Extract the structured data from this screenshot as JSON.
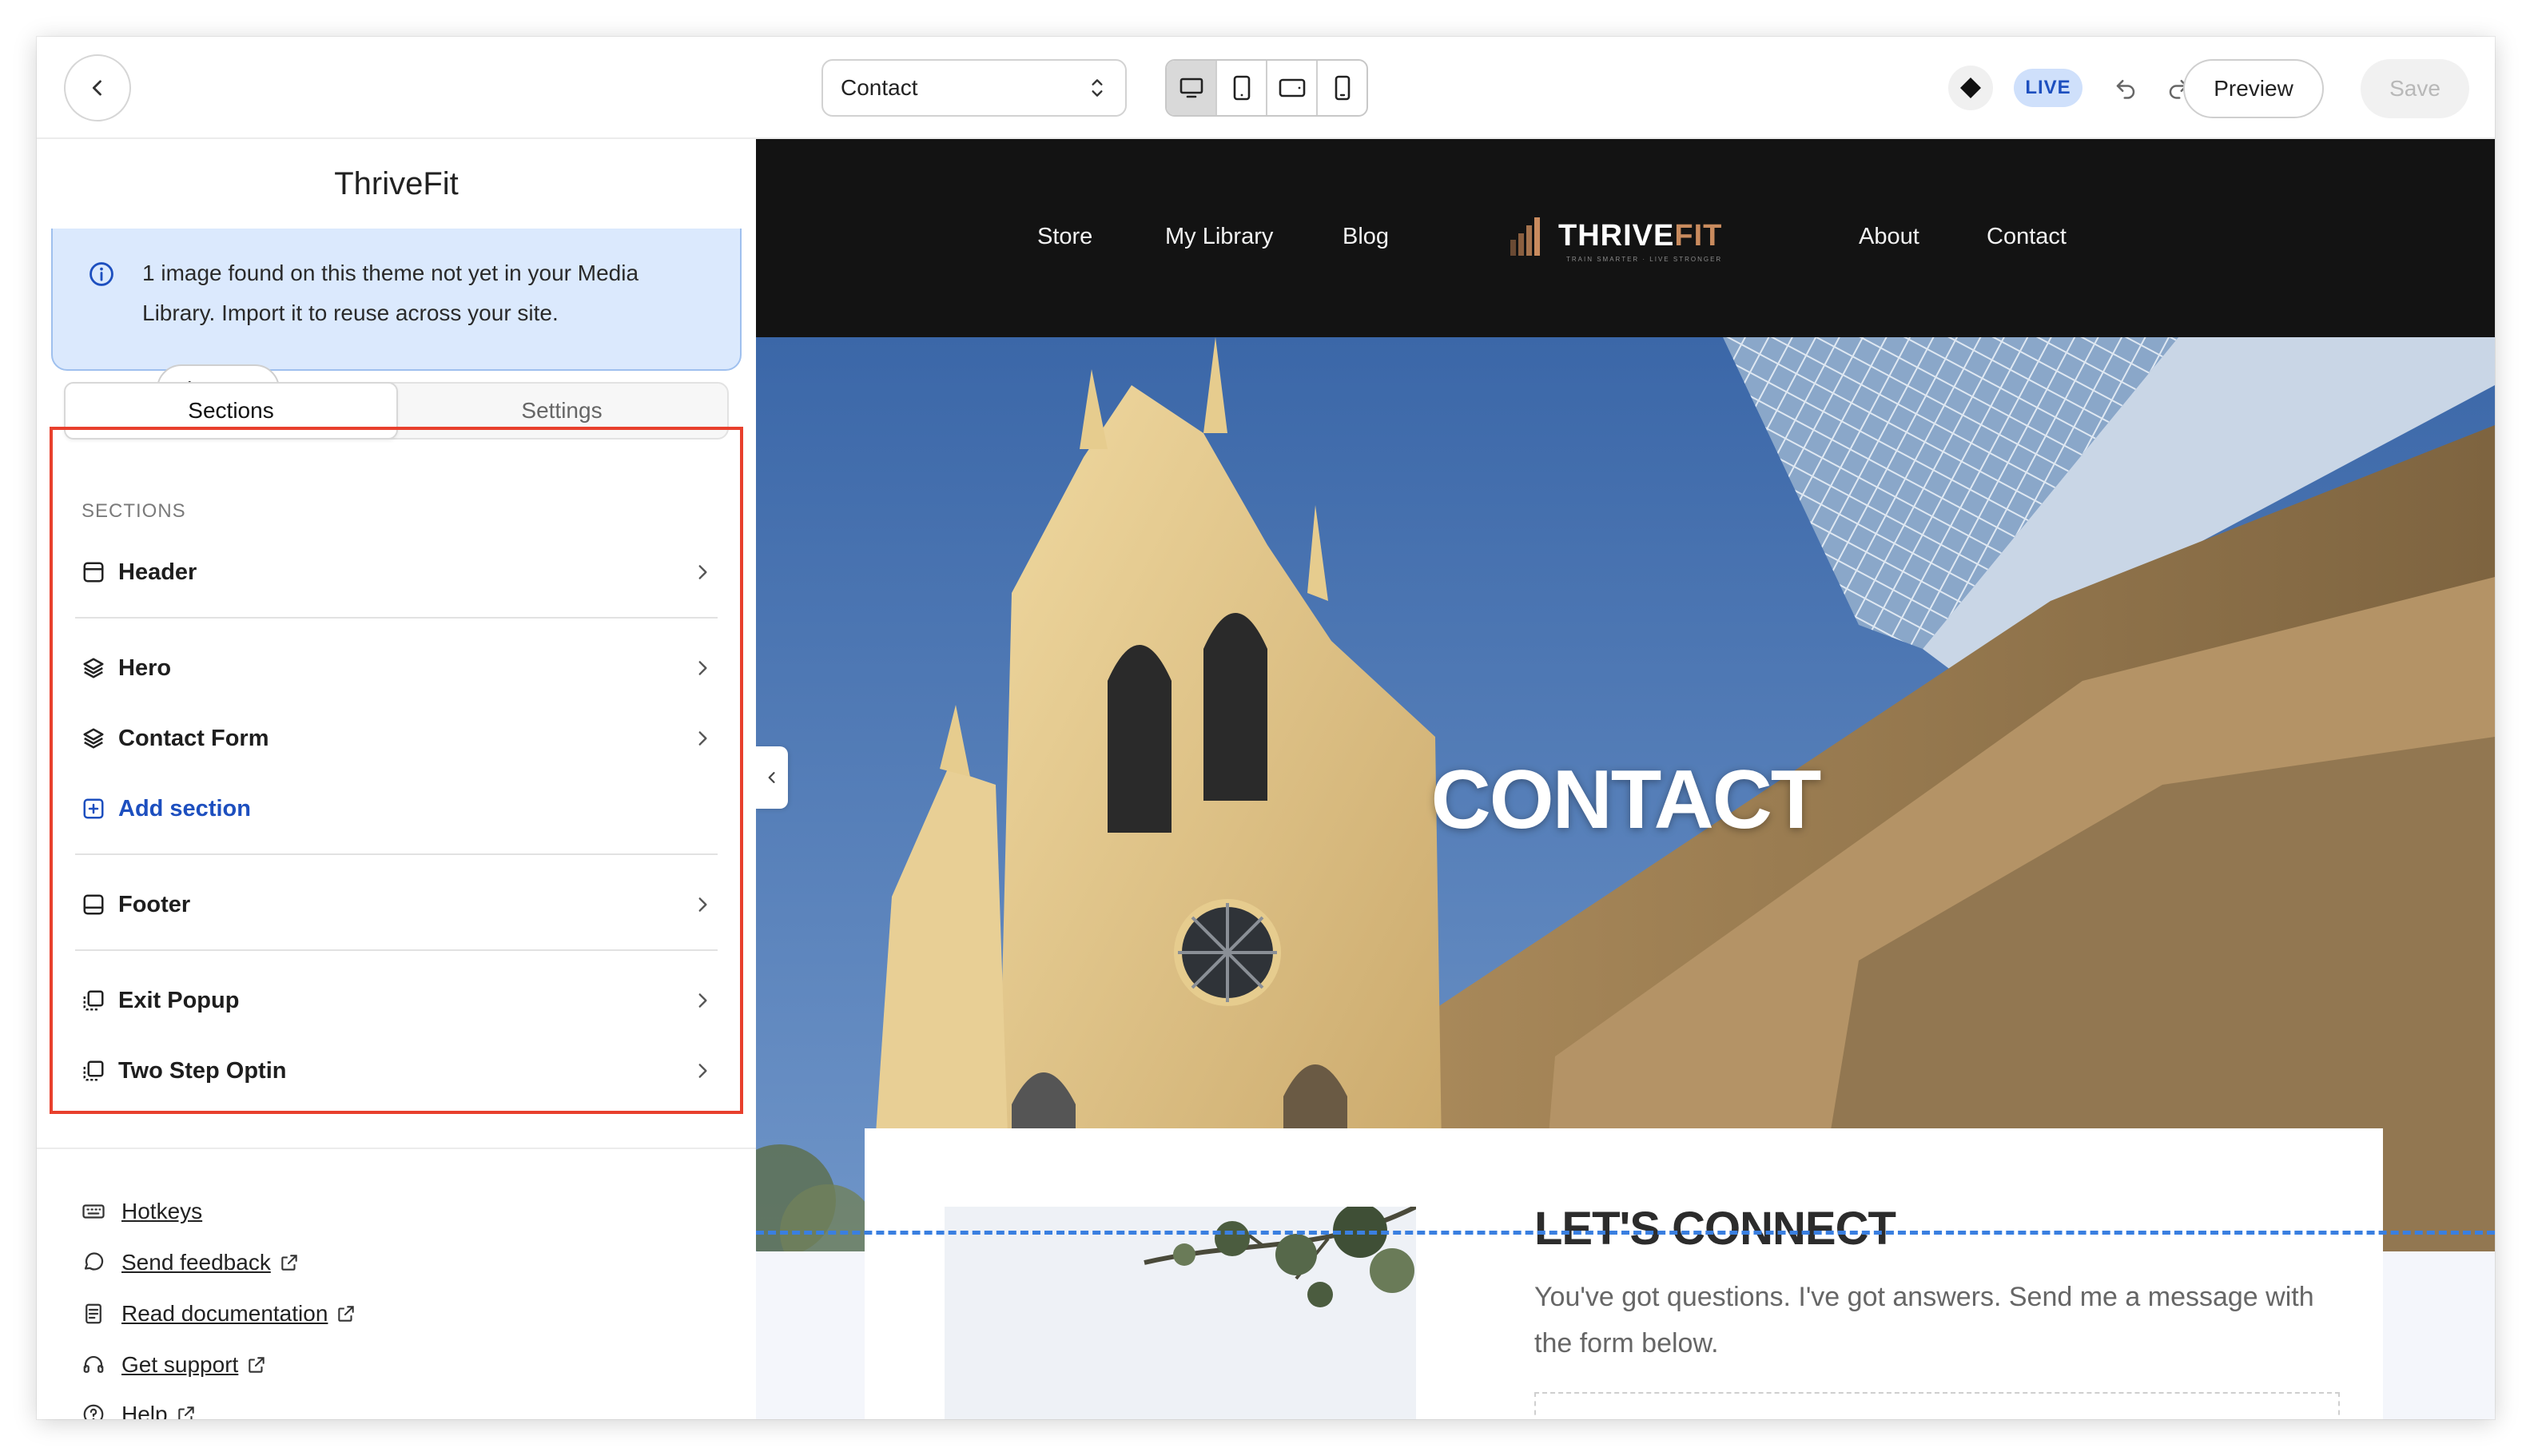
{
  "toolbar": {
    "page_select": {
      "value": "Contact"
    },
    "devices": [
      "desktop-icon",
      "tablet-portrait-icon",
      "tablet-landscape-icon",
      "mobile-icon"
    ],
    "live_label": "LIVE",
    "preview_label": "Preview",
    "save_label": "Save"
  },
  "sidebar": {
    "site_name": "ThriveFit",
    "notice": {
      "line1": "1 image found on this theme not yet in your Media",
      "line2": "Library. Import it to reuse across your site.",
      "import_label": "Import"
    },
    "tabs": [
      {
        "label": "Sections",
        "active": true
      },
      {
        "label": "Settings",
        "active": false
      }
    ],
    "sections_caption": "SECTIONS",
    "sections": [
      {
        "label": "Header",
        "icon": "layout-header-icon"
      },
      {
        "label": "Hero",
        "icon": "layers-icon"
      },
      {
        "label": "Contact Form",
        "icon": "layers-icon"
      },
      {
        "label": "Add section",
        "icon": "plus-square-icon"
      },
      {
        "label": "Footer",
        "icon": "layout-footer-icon"
      },
      {
        "label": "Exit Popup",
        "icon": "popup-icon"
      },
      {
        "label": "Two Step Optin",
        "icon": "popup-icon"
      }
    ],
    "links": [
      {
        "label": "Hotkeys",
        "icon": "keyboard-icon"
      },
      {
        "label": "Send feedback",
        "icon": "chat-bubble-icon"
      },
      {
        "label": "Read documentation",
        "icon": "document-icon"
      },
      {
        "label": "Get support",
        "icon": "headset-icon"
      },
      {
        "label": "Help",
        "icon": "help-circle-icon"
      }
    ]
  },
  "site": {
    "nav": {
      "store": "Store",
      "library": "My Library",
      "blog": "Blog",
      "about": "About",
      "contact": "Contact"
    },
    "logo_main": "THRIVE",
    "logo_accent": "FIT",
    "logo_tagline": "TRAIN SMARTER · LIVE STRONGER",
    "hero_title": "CONTACT",
    "connect_title": "LET'S CONNECT",
    "connect_body": "You've got questions. I've got answers. Send me a message with the form below."
  },
  "colors": {
    "accent": "#1d4fbf",
    "highlight": "#e8402d",
    "live_bg": "#cfe0fb",
    "nav_bg": "#131313",
    "logo_accent": "#c98b5e",
    "guide": "#3a7fe0"
  }
}
